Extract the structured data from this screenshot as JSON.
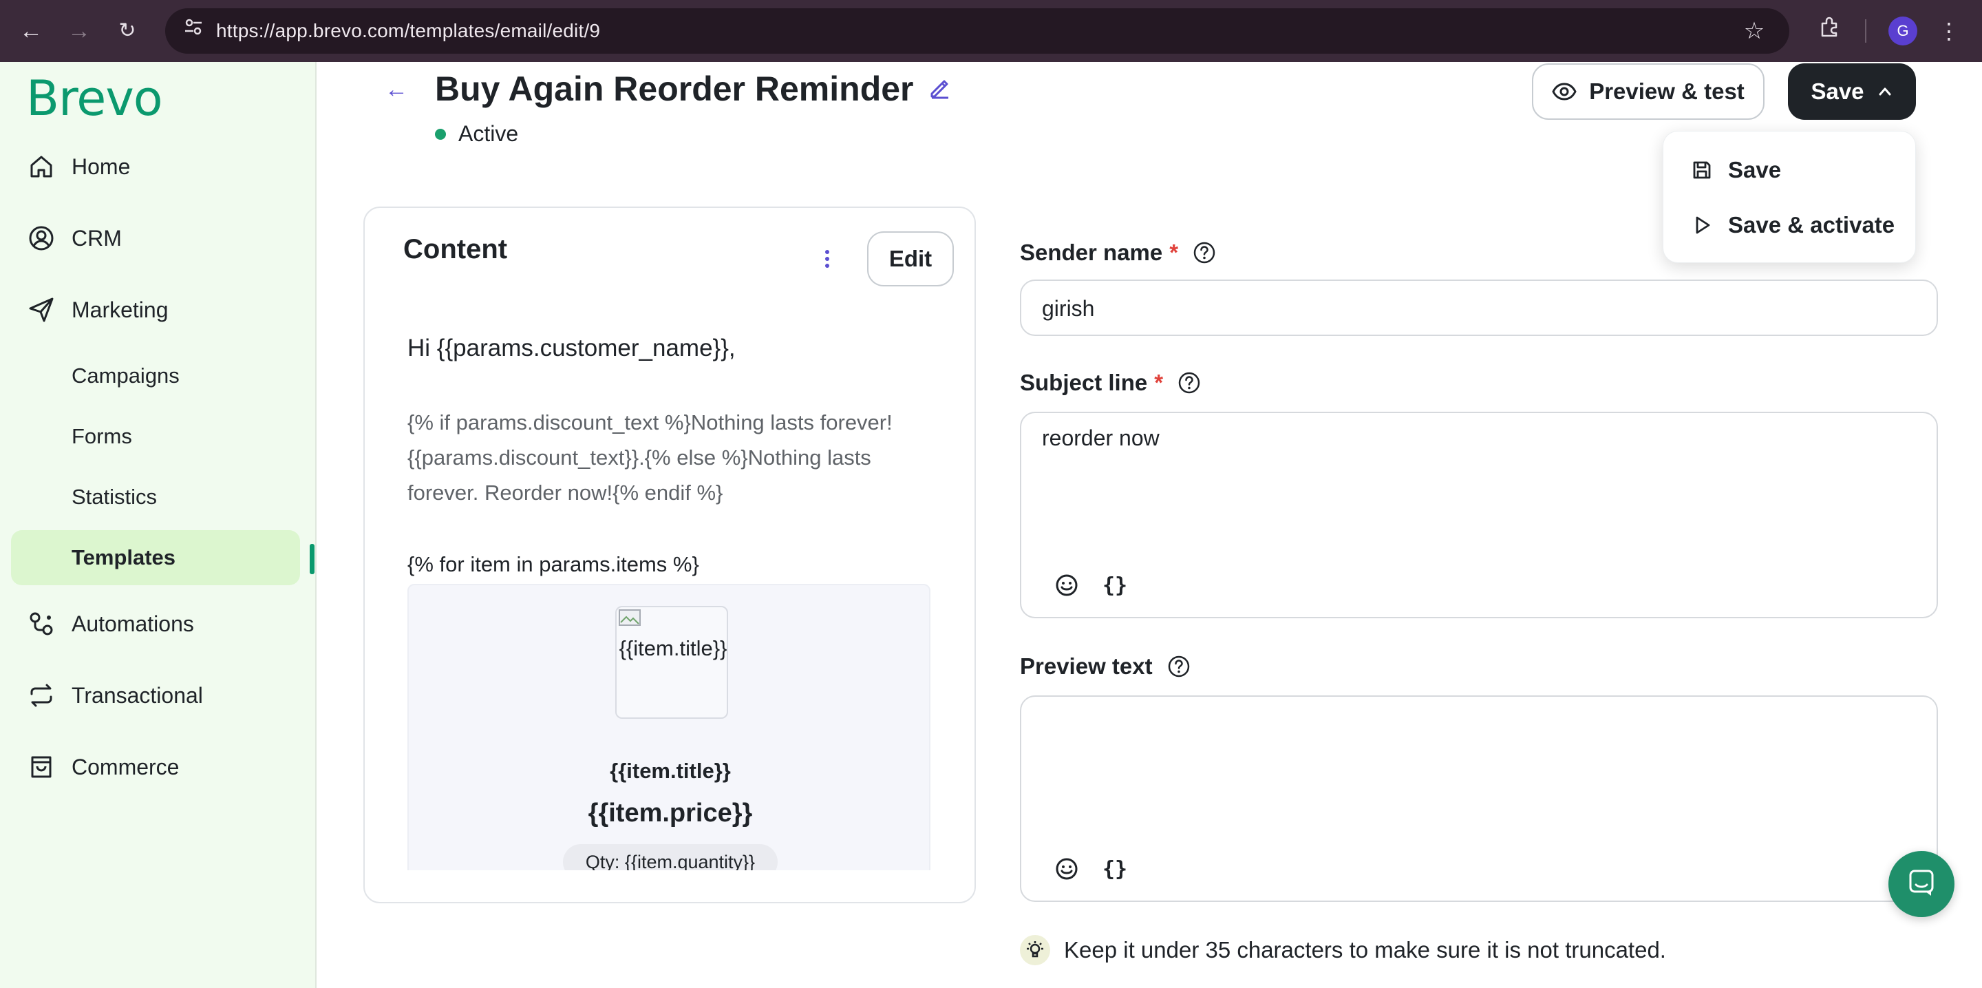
{
  "browser": {
    "url": "https://app.brevo.com/templates/email/edit/9",
    "profile_initial": "G"
  },
  "sidebar": {
    "logo": "Brevo",
    "items": [
      {
        "label": "Home",
        "icon": "home-icon"
      },
      {
        "label": "CRM",
        "icon": "contact-icon"
      },
      {
        "label": "Marketing",
        "icon": "send-icon"
      },
      {
        "label": "Automations",
        "icon": "automation-icon"
      },
      {
        "label": "Transactional",
        "icon": "repeat-icon"
      },
      {
        "label": "Commerce",
        "icon": "bag-icon"
      }
    ],
    "marketing_sub": [
      "Campaigns",
      "Forms",
      "Statistics",
      "Templates"
    ],
    "active_sub": "Templates"
  },
  "header": {
    "title": "Buy Again Reorder Reminder",
    "status": "Active",
    "preview_button": "Preview & test",
    "save_button": "Save"
  },
  "save_menu": {
    "items": [
      {
        "label": "Save",
        "icon": "floppy-icon"
      },
      {
        "label": "Save & activate",
        "icon": "play-icon"
      }
    ]
  },
  "content_card": {
    "title": "Content",
    "edit_button": "Edit",
    "email": {
      "greeting": "Hi {{params.customer_name}},",
      "conditional": "{% if params.discount_text %}Nothing lasts forever! {{params.discount_text}}.{% else %}Nothing lasts forever. Reorder now!{% endif %}",
      "loop": "{% for item in params.items %}",
      "item_image_alt": "{{item.title}}",
      "item_title": "{{item.title}}",
      "item_price": "{{item.price}}",
      "item_qty": "Qty: {{item.quantity}}"
    }
  },
  "form": {
    "sender_name": {
      "label": "Sender name",
      "required": "*",
      "value": "girish"
    },
    "subject_line": {
      "label": "Subject line",
      "required": "*",
      "value": "reorder now"
    },
    "preview_text": {
      "label": "Preview text",
      "value": ""
    },
    "braces_tool": "{}",
    "tip": "Keep it under 35 characters to make sure it is not truncated."
  },
  "colors": {
    "brand_green": "#0b996e",
    "sidebar_bg": "#f1fbef",
    "active_bg": "#dcf6cf",
    "required_red": "#e0413a",
    "save_button_bg": "#1f2328",
    "accent_purple": "#5b4fd1"
  }
}
